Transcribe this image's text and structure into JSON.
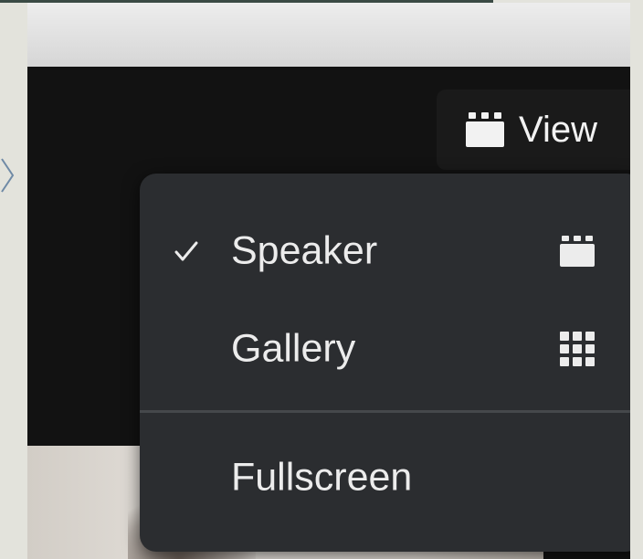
{
  "toolbar": {
    "view_label": "View",
    "view_icon": "speaker-layout-icon"
  },
  "view_menu": {
    "selected": "Speaker",
    "items": [
      {
        "label": "Speaker",
        "checked": true,
        "icon": "speaker-layout-icon"
      },
      {
        "label": "Gallery",
        "checked": false,
        "icon": "gallery-grid-icon"
      },
      {
        "label": "Fullscreen",
        "checked": false,
        "icon": ""
      }
    ]
  },
  "colors": {
    "menu_background": "#2b2d30",
    "menu_text": "#ececec",
    "window_background": "#121212",
    "page_background": "#e3e3dc"
  }
}
